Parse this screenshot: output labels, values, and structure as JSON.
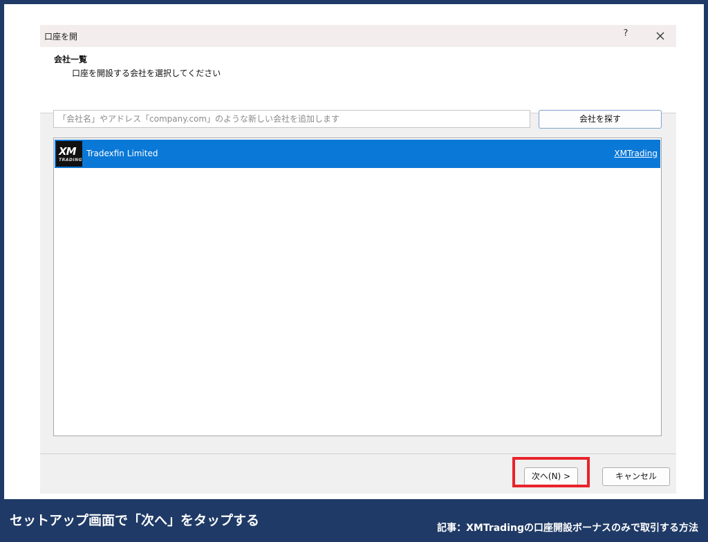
{
  "dialog": {
    "title": "口座を開",
    "help_label": "?",
    "header_title": "会社一覧",
    "header_subtitle": "口座を開設する会社を選択してください",
    "search": {
      "placeholder": "「会社名」やアドレス「company.com」のような新しい会社を追加します",
      "value": ""
    },
    "find_button_label": "会社を探す",
    "companies": [
      {
        "logo_text": "XM",
        "logo_subtext": "TRADING",
        "name": "Tradexfin Limited",
        "link": "XMTrading",
        "selected": true
      }
    ],
    "next_button_label": "次へ(N) >",
    "cancel_button_label": "キャンセル"
  },
  "caption": {
    "left": "セットアップ画面で「次へ」をタップする",
    "right": "記事：XMTradingの口座開設ボーナスのみで取引する方法"
  },
  "colors": {
    "frame": "#1f3a66",
    "selection": "#0a78d7",
    "highlight": "#e8232b"
  }
}
